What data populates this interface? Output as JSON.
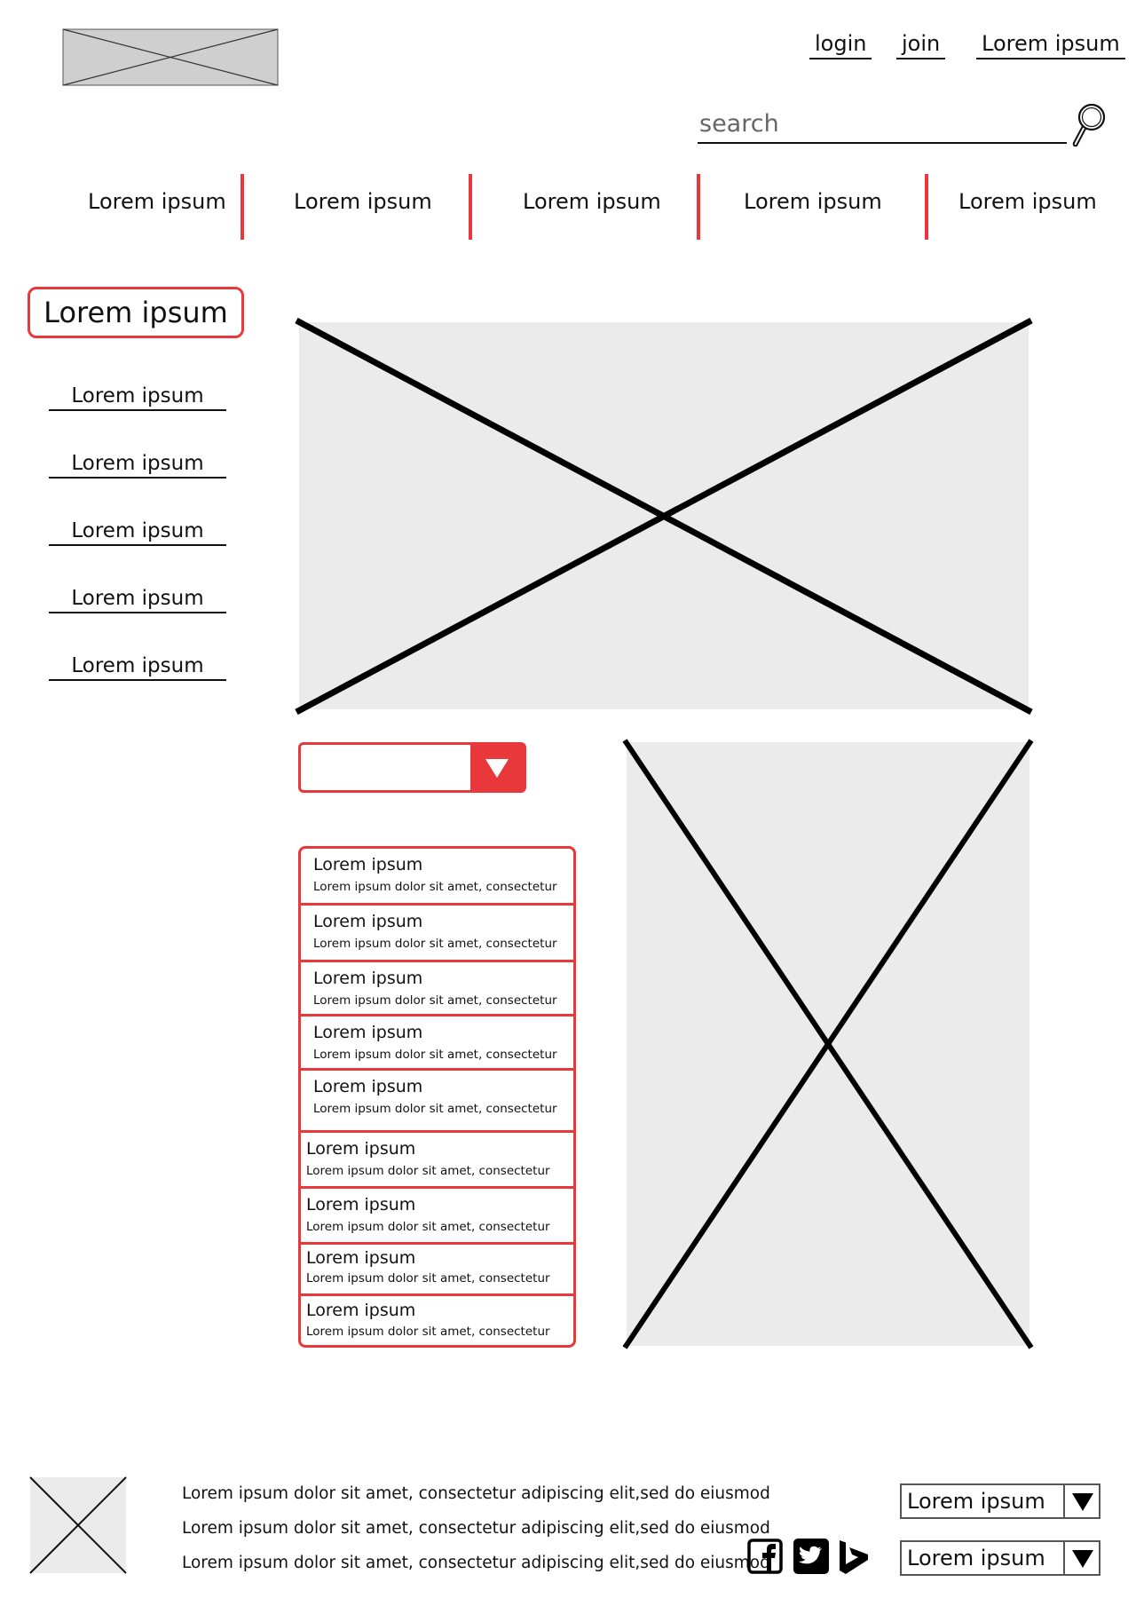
{
  "header": {
    "logo": "logo-placeholder",
    "links": [
      "login",
      "join",
      "Lorem ipsum"
    ],
    "search": {
      "placeholder": "search",
      "value": "",
      "icon": "search-icon"
    }
  },
  "nav": {
    "items": [
      "Lorem ipsum",
      "Lorem ipsum",
      "Lorem ipsum",
      "Lorem ipsum",
      "Lorem ipsum"
    ]
  },
  "sidebar": {
    "title": "Lorem ipsum",
    "items": [
      "Lorem ipsum",
      "Lorem ipsum",
      "Lorem ipsum",
      "Lorem ipsum",
      "Lorem ipsum"
    ]
  },
  "main": {
    "hero_image": "image-placeholder",
    "side_image": "image-placeholder",
    "dropdown": {
      "value": "",
      "icon": "chevron-down-icon"
    },
    "list": [
      {
        "title": "Lorem ipsum",
        "subtitle": "Lorem ipsum dolor sit amet, consectetur"
      },
      {
        "title": "Lorem ipsum",
        "subtitle": "Lorem ipsum dolor sit amet, consectetur"
      },
      {
        "title": "Lorem ipsum",
        "subtitle": "Lorem ipsum dolor sit amet, consectetur"
      },
      {
        "title": "Lorem ipsum",
        "subtitle": "Lorem ipsum dolor sit amet, consectetur"
      },
      {
        "title": "Lorem ipsum",
        "subtitle": "Lorem ipsum dolor sit amet, consectetur"
      },
      {
        "title": "Lorem ipsum",
        "subtitle": "Lorem ipsum dolor sit amet, consectetur"
      },
      {
        "title": "Lorem ipsum",
        "subtitle": "Lorem ipsum dolor sit amet, consectetur"
      },
      {
        "title": "Lorem ipsum",
        "subtitle": "Lorem ipsum dolor sit amet, consectetur"
      },
      {
        "title": "Lorem ipsum",
        "subtitle": "Lorem ipsum dolor sit amet, consectetur"
      }
    ]
  },
  "footer": {
    "logo": "image-placeholder",
    "lines": [
      "Lorem ipsum dolor sit amet, consectetur adipiscing elit,sed do eiusmod",
      "Lorem ipsum dolor sit amet, consectetur adipiscing elit,sed do eiusmod",
      "Lorem ipsum dolor sit amet, consectetur adipiscing elit,sed do eiusmod"
    ],
    "social": [
      "facebook-icon",
      "twitter-icon",
      "bing-icon"
    ],
    "selects": [
      "Lorem ipsum",
      "Lorem ipsum"
    ]
  },
  "colors": {
    "accent": "#e8383b",
    "placeholder_fill": "#ebebeb",
    "text": "#111111"
  }
}
